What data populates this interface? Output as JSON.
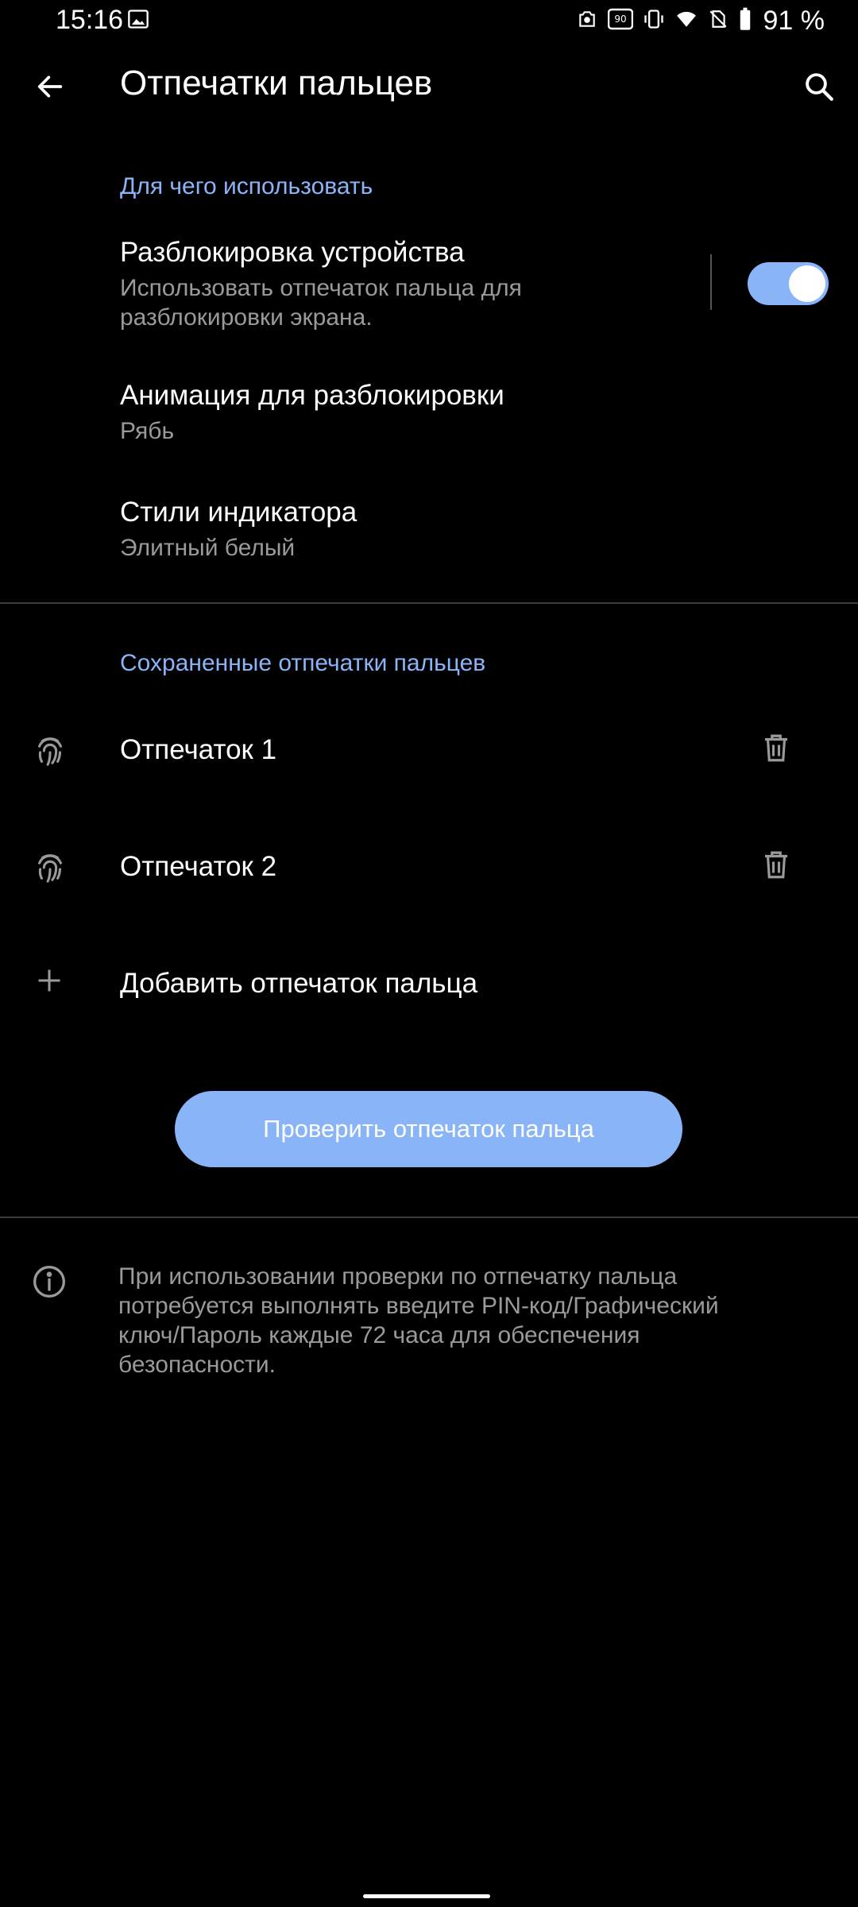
{
  "status_bar": {
    "time": "15:16",
    "battery_percent": "91 %"
  },
  "app_bar": {
    "title": "Отпечатки пальцев",
    "back_icon": "arrow-back-icon",
    "search_icon": "search-icon"
  },
  "usage_section": {
    "header": "Для чего использовать",
    "unlock": {
      "title": "Разблокировка устройства",
      "subtitle_line1": "Использовать отпечаток пальца для",
      "subtitle_line2": "разблокировки экрана.",
      "enabled": true
    },
    "animation": {
      "title": "Анимация для разблокировки",
      "value": "Рябь"
    },
    "indicator": {
      "title": "Стили индикатора",
      "value": "Элитный белый"
    }
  },
  "saved_section": {
    "header": "Сохраненные отпечатки пальцев",
    "items": [
      {
        "label": "Отпечаток 1",
        "icon": "fingerprint-icon",
        "action_icon": "trash-icon"
      },
      {
        "label": "Отпечаток 2",
        "icon": "fingerprint-icon",
        "action_icon": "trash-icon"
      }
    ],
    "add_label": "Добавить отпечаток пальца",
    "add_icon": "plus-icon"
  },
  "verify_button": "Проверить отпечаток пальца",
  "info": {
    "icon": "info-icon",
    "line1": "При использовании проверки по отпечатку пальца",
    "line2": "потребуется выполнять введите PIN-код/Графический",
    "line3": "ключ/Пароль каждые 72 часа для обеспечения",
    "line4": "безопасности."
  },
  "colors": {
    "accent": "#8ab4f8",
    "background": "#000000",
    "secondary_text": "#9a9a9a"
  }
}
